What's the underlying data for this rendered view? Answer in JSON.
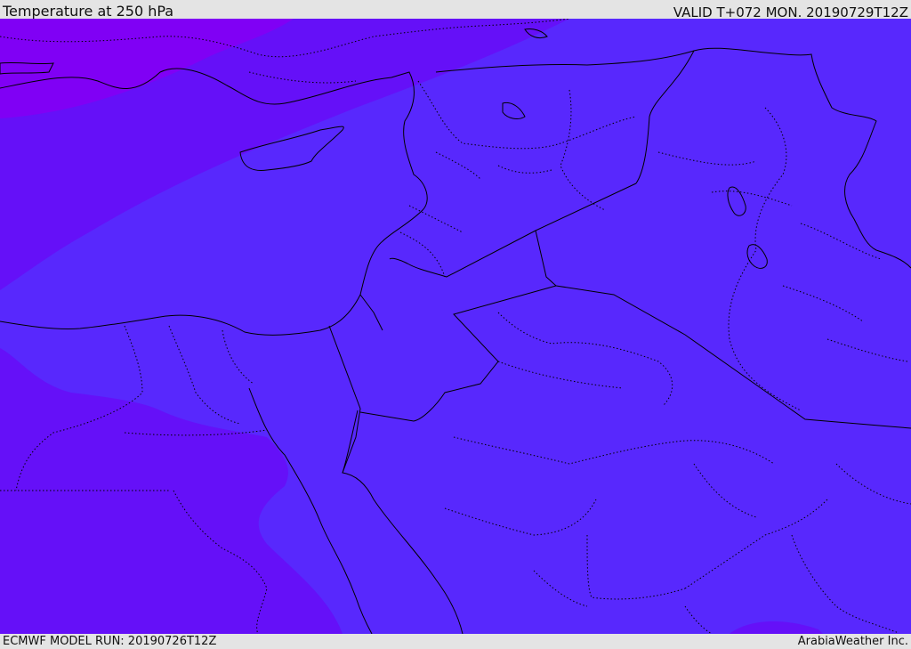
{
  "header": {
    "title": "Temperature at 250 hPa",
    "valid": "VALID T+072 MON. 20190729T12Z"
  },
  "footer": {
    "model_run": "ECMWF MODEL RUN: 20190726T12Z",
    "credit": "ArabiaWeather Inc."
  },
  "colors": {
    "field_cold": "#8000f5",
    "field_mid": "#6510f8",
    "field_warm": "#5828fd",
    "border": "#000000",
    "bar_background": "#e4e4e4"
  }
}
